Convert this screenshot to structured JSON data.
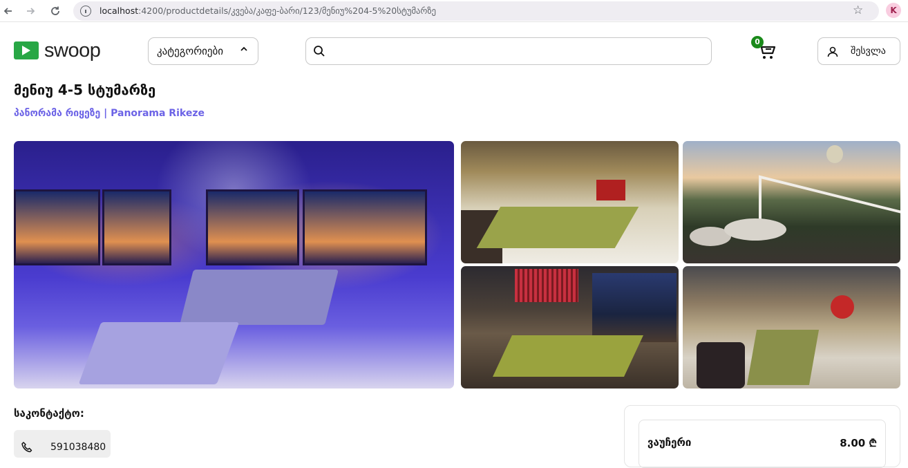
{
  "browser": {
    "url_host": "localhost",
    "url_path": ":4200/productdetails/კვება/კაფე-ბარი/123/მენიუ%204-5%20სტუმარზე",
    "profile_initial": "K"
  },
  "header": {
    "logo_text": "swoop",
    "categories_label": "კატეგორიები",
    "search_placeholder": "",
    "cart_count": "0",
    "login_label": "შესვლა"
  },
  "product": {
    "title": "მენიუ 4-5 სტუმარზე",
    "venue": "პანორამა რიყეზე | Panorama Rikeze"
  },
  "contact": {
    "label": "საკონტაქტო:",
    "phone": "591038480"
  },
  "pricing": {
    "voucher_label": "ვაუჩერი",
    "voucher_price": "8.00 ₾"
  },
  "colors": {
    "brand_green": "#28a745",
    "venue_link": "#6c63e6",
    "badge_green": "#1a8a1a"
  }
}
